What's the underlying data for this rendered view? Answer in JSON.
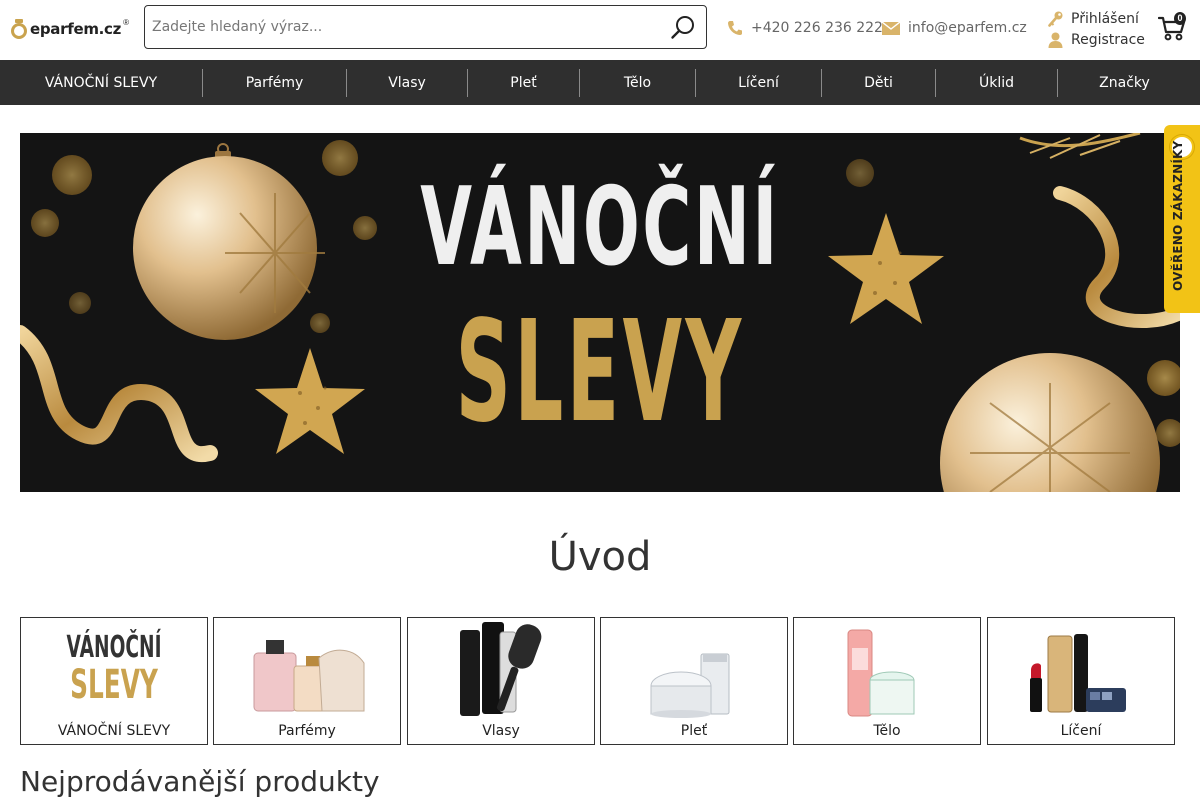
{
  "header": {
    "logo_text": "eparfem.cz",
    "logo_sup": "®",
    "search_placeholder": "Zadejte hledaný výraz...",
    "phone": "+420 226 236 222",
    "email": "info@eparfem.cz",
    "login": "Přihlášení",
    "register": "Registrace",
    "cart_count": "0",
    "icons": [
      "search-icon",
      "phone-icon",
      "mail-icon",
      "key-icon",
      "user-icon",
      "cart-icon"
    ],
    "accent_color": "#c9a34e"
  },
  "nav": {
    "items": [
      {
        "label": "VÁNOČNÍ SLEVY"
      },
      {
        "label": "Parfémy"
      },
      {
        "label": "Vlasy"
      },
      {
        "label": "Pleť"
      },
      {
        "label": "Tělo"
      },
      {
        "label": "Líčení"
      },
      {
        "label": "Děti"
      },
      {
        "label": "Úklid"
      },
      {
        "label": "Značky"
      }
    ],
    "background": "#2f2f2f"
  },
  "banner": {
    "line1": "VÁNOČNÍ",
    "line2": "SLEVY",
    "gold": "#c9a24f"
  },
  "side_tab": {
    "label": "OVĚŘENO ZÁKAZNÍKY",
    "color": "#f2c316"
  },
  "intro": {
    "title": "Úvod",
    "categories": [
      {
        "label": "VÁNOČNÍ SLEVY"
      },
      {
        "label": "Parfémy"
      },
      {
        "label": "Vlasy"
      },
      {
        "label": "Pleť"
      },
      {
        "label": "Tělo"
      },
      {
        "label": "Líčení"
      }
    ],
    "thumb_line1": "VÁNOČNÍ",
    "thumb_line2": "SLEVY"
  },
  "bestsellers": {
    "title": "Nejprodávanější produkty"
  }
}
